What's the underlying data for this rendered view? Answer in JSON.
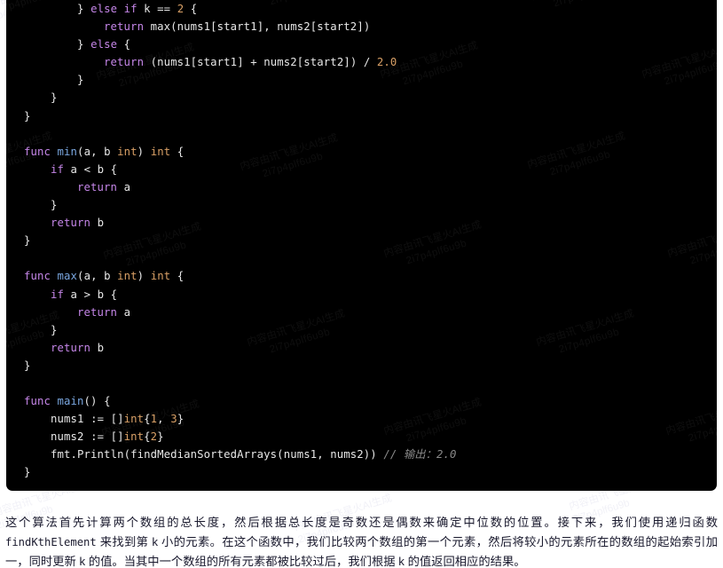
{
  "code_block": {
    "language": "go",
    "background": "#000000",
    "lines": [
      "        } else if k == 2 {",
      "            return max(nums1[start1], nums2[start2])",
      "        } else {",
      "            return (nums1[start1] + nums2[start2]) / 2.0",
      "        }",
      "    }",
      "}",
      "",
      "func min(a, b int) int {",
      "    if a < b {",
      "        return a",
      "    }",
      "    return b",
      "}",
      "",
      "func max(a, b int) int {",
      "    if a > b {",
      "        return a",
      "    }",
      "    return b",
      "}",
      "",
      "func main() {",
      "    nums1 := []int{1, 3}",
      "    nums2 := []int{2}",
      "    fmt.Println(findMedianSortedArrays(nums1, nums2)) // 输出：2.0",
      "}"
    ],
    "inline_comment": "// 输出：2.0",
    "colors": {
      "keyword": "#c586e8",
      "function": "#7aa7e0",
      "type": "#d9a066",
      "number": "#d9a066",
      "comment": "#8a8a8a",
      "plain": "#e8e8e8"
    }
  },
  "watermark": {
    "line1": "内容由讯飞星火AI生成",
    "line2": "2i7p4plf6u9b"
  },
  "description": {
    "part1": "这个算法首先计算两个数组的总长度，然后根据总长度是奇数还是偶数来确定中位数的位置。接下来，我们使用递归函数 ",
    "code1": "findKthElement",
    "part2": " 来找到第 k 小的元素。在这个函数中，我们比较两个数组的第一个元素，然后将较小的元素所在的数组的起始索引加一，同时更新 k 的值。当其中一个数组的所有元素都被比较过后，我们根据 k 的值返回相应的结果。"
  }
}
